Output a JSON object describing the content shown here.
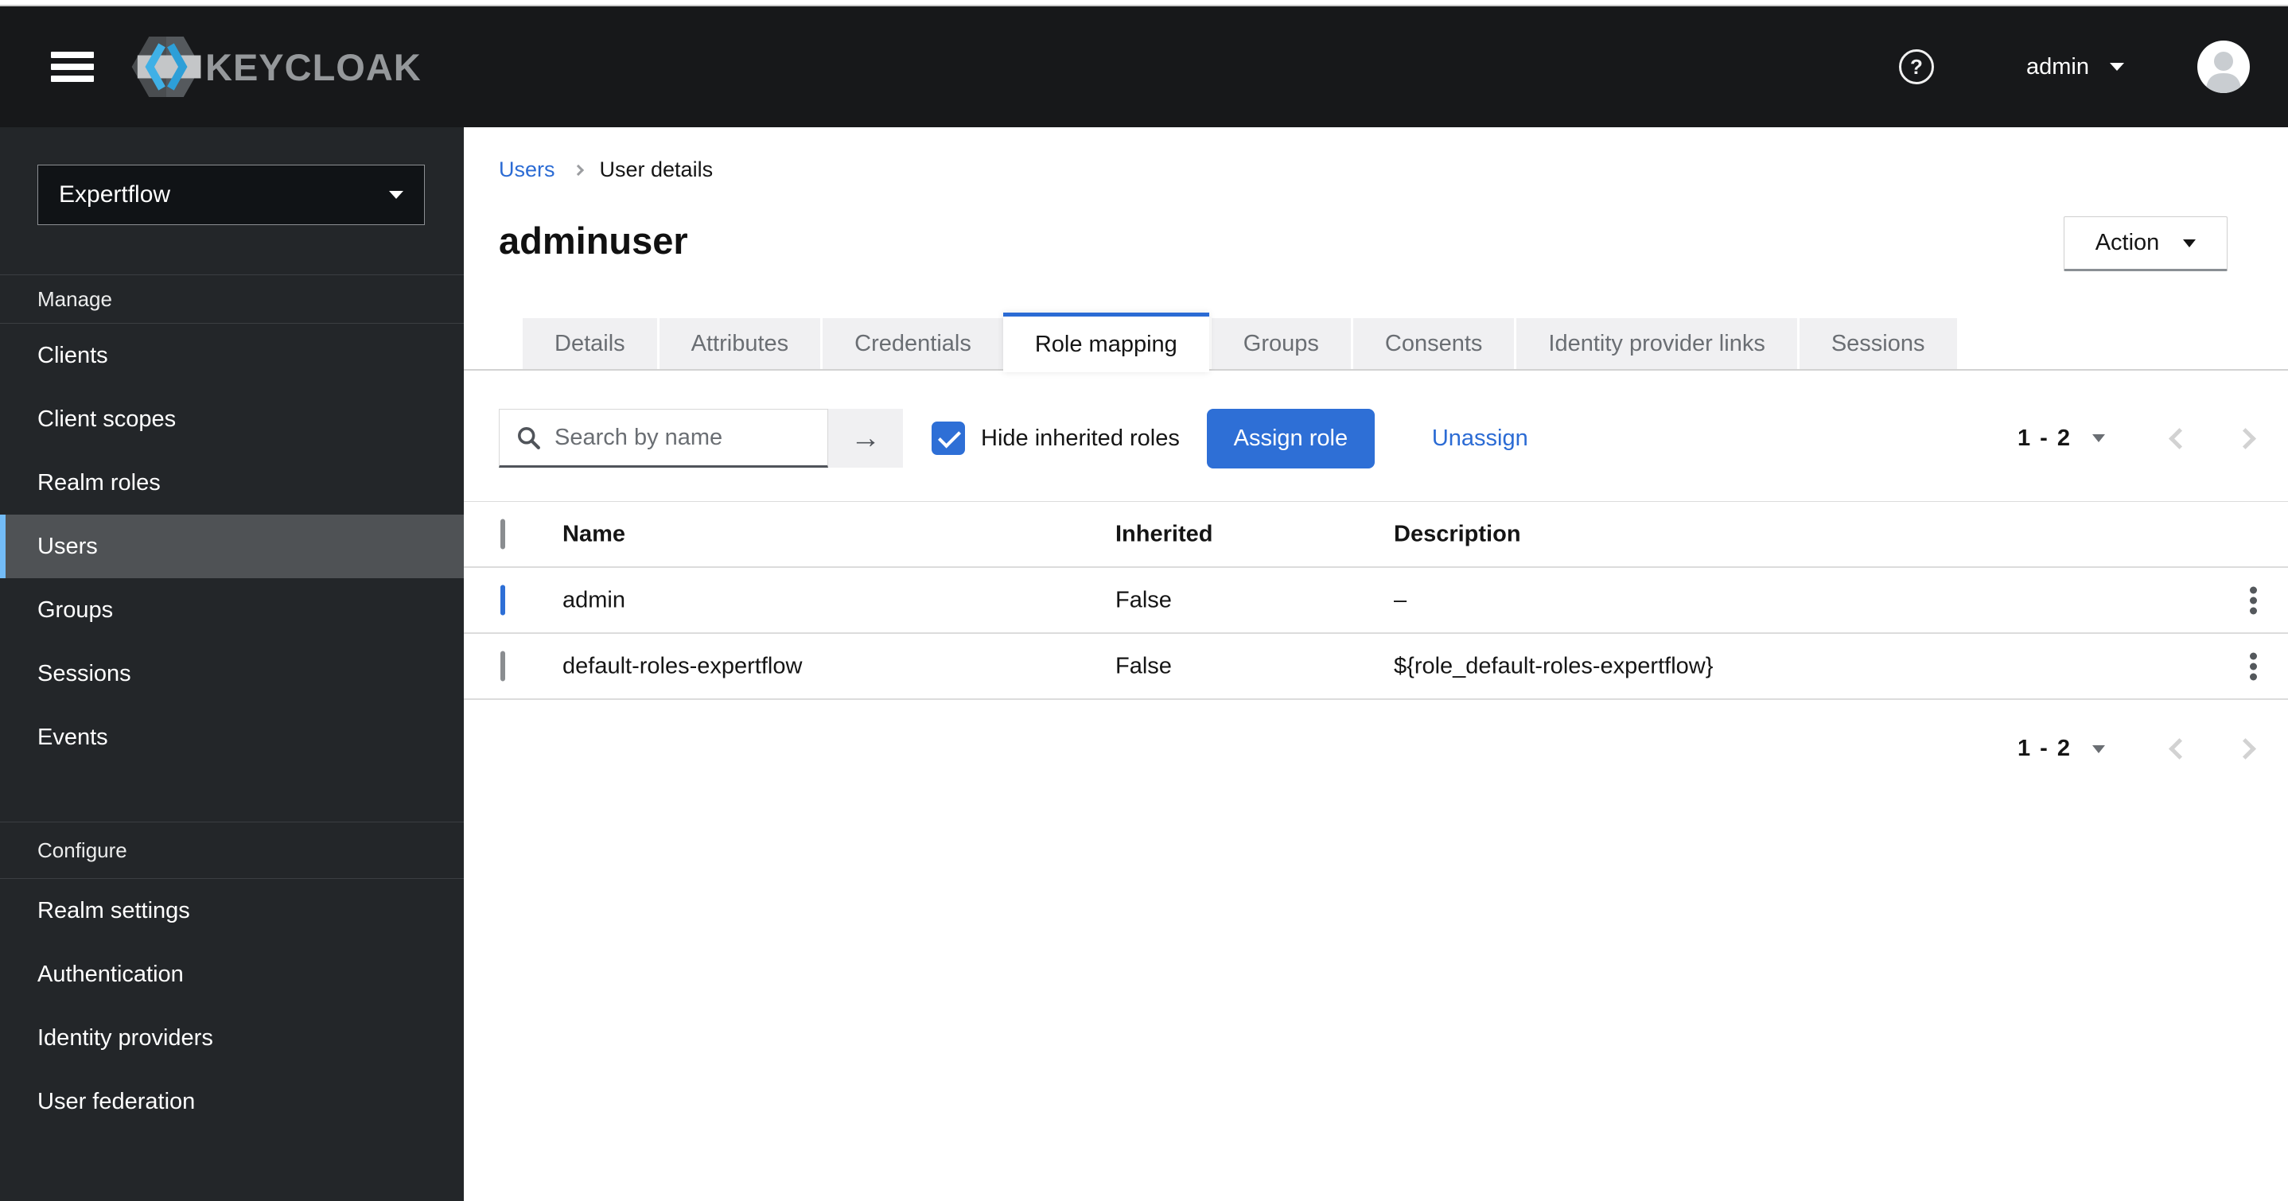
{
  "header": {
    "brand": "KEYCLOAK",
    "help_icon": "?",
    "username": "admin"
  },
  "sidebar": {
    "realm": "Expertflow",
    "sections": [
      {
        "label": "Manage",
        "items": [
          "Clients",
          "Client scopes",
          "Realm roles",
          "Users",
          "Groups",
          "Sessions",
          "Events"
        ],
        "selected": "Users"
      },
      {
        "label": "Configure",
        "items": [
          "Realm settings",
          "Authentication",
          "Identity providers",
          "User federation"
        ]
      }
    ]
  },
  "breadcrumb": {
    "parent": "Users",
    "current": "User details"
  },
  "page": {
    "title": "adminuser",
    "action": "Action"
  },
  "tabs": {
    "items": [
      "Details",
      "Attributes",
      "Credentials",
      "Role mapping",
      "Groups",
      "Consents",
      "Identity provider links",
      "Sessions"
    ],
    "active": "Role mapping"
  },
  "toolbar": {
    "search_placeholder": "Search by name",
    "search_button_icon": "→",
    "hide_inherited": "Hide inherited roles",
    "hide_inherited_checked": true,
    "assign": "Assign role",
    "unassign": "Unassign"
  },
  "pagination": {
    "range": "1 - 2"
  },
  "table": {
    "columns": [
      "Name",
      "Inherited",
      "Description"
    ],
    "rows": [
      {
        "checked": true,
        "name": "admin",
        "inherited": "False",
        "description": "–"
      },
      {
        "checked": false,
        "name": "default-roles-expertflow",
        "inherited": "False",
        "description": "${role_default-roles-expertflow}"
      }
    ]
  },
  "colors": {
    "masthead_bg": "#17181a",
    "sidebar_bg": "#232629",
    "selected_item_bg": "#4f5255",
    "selected_item_accent": "#73bcf7",
    "primary_blue": "#2e6fd6",
    "link_blue": "#2b6bd4",
    "tab_inactive_bg": "#f0f0f2",
    "muted_text": "#6a6e73"
  }
}
